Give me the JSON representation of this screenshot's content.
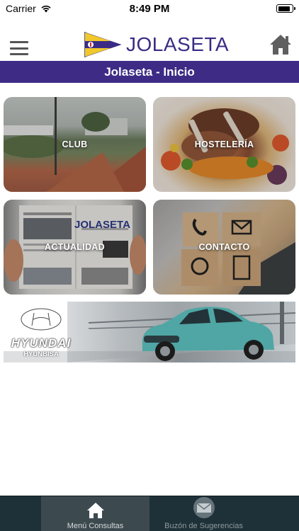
{
  "status_bar": {
    "carrier": "Carrier",
    "time": "8:49 PM",
    "battery_level": 0.85
  },
  "header": {
    "logo_text": "JOLASETA",
    "menu_icon": "hamburger-icon",
    "home_icon": "home-icon"
  },
  "title_bar": {
    "title": "Jolaseta - Inicio"
  },
  "tiles": [
    {
      "label": "CLUB"
    },
    {
      "label": "HOSTELERÍA"
    },
    {
      "label": "ACTUALIDAD",
      "image_text": "JOLASETA"
    },
    {
      "label": "CONTACTO"
    }
  ],
  "ad": {
    "brand": "HYUNDAI",
    "dealer": "HYUNBISA",
    "car_color": "#4fa6a4"
  },
  "tab_bar": {
    "tabs": [
      {
        "label": "Menú Consultas",
        "icon": "home-icon",
        "active": true
      },
      {
        "label": "Buzón de Sugerencias",
        "icon": "envelope-icon",
        "active": false
      }
    ]
  },
  "colors": {
    "primary": "#3d2b85",
    "tabbar": "#1f3138"
  }
}
